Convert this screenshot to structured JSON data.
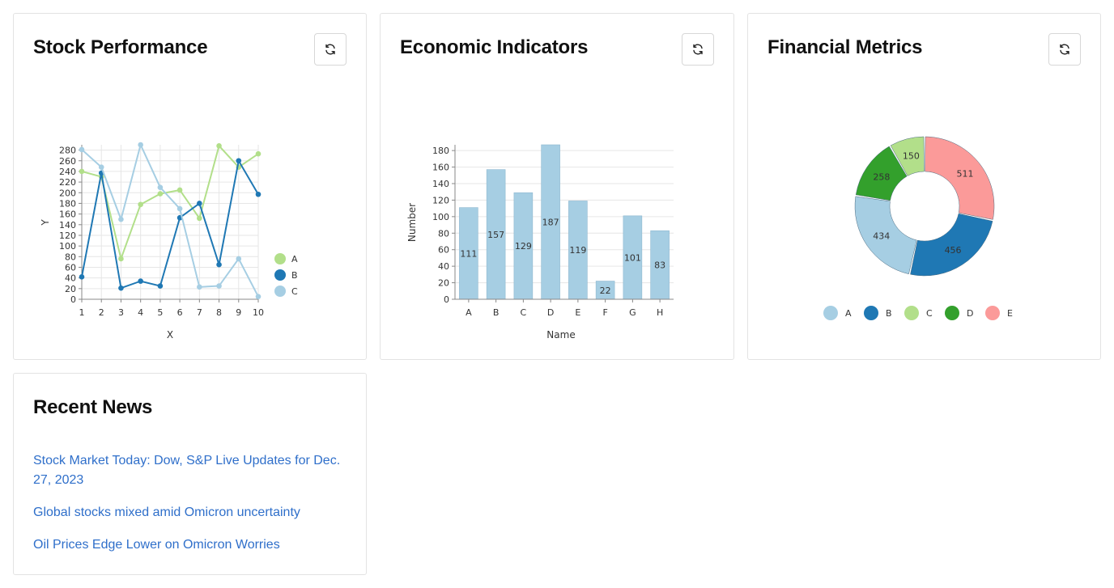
{
  "cards": {
    "stock": {
      "title": "Stock Performance",
      "refresh_icon": "refresh-icon"
    },
    "economic": {
      "title": "Economic Indicators",
      "refresh_icon": "refresh-icon"
    },
    "financial": {
      "title": "Financial Metrics",
      "refresh_icon": "refresh-icon"
    },
    "news": {
      "title": "Recent News"
    }
  },
  "news": [
    "Stock Market Today: Dow, S&P Live Updates for Dec. 27, 2023",
    "Global stocks mixed amid Omicron uncertainty",
    "Oil Prices Edge Lower on Omicron Worries"
  ],
  "colors": {
    "lightblue": "#a6cee3",
    "blue": "#1f78b4",
    "lightgreen": "#b2df8a",
    "green": "#33a02c",
    "pink": "#fb9a99",
    "link": "#2f6fca"
  },
  "chart_data": [
    {
      "type": "line",
      "xlabel": "X",
      "ylabel": "Y",
      "x": [
        1,
        2,
        3,
        4,
        5,
        6,
        7,
        8,
        9,
        10
      ],
      "ylim": [
        0,
        290
      ],
      "yticks": [
        0,
        20,
        40,
        60,
        80,
        100,
        120,
        140,
        160,
        180,
        200,
        220,
        240,
        260,
        280
      ],
      "grid": true,
      "legend": "right",
      "series": [
        {
          "name": "A",
          "color": "#b2df8a",
          "values": [
            240,
            230,
            76,
            178,
            198,
            205,
            152,
            288,
            248,
            273
          ]
        },
        {
          "name": "B",
          "color": "#1f78b4",
          "values": [
            42,
            237,
            21,
            34,
            25,
            153,
            180,
            65,
            260,
            197
          ]
        },
        {
          "name": "C",
          "color": "#a6cee3",
          "values": [
            281,
            248,
            150,
            290,
            210,
            170,
            23,
            25,
            76,
            5
          ]
        }
      ]
    },
    {
      "type": "bar",
      "xlabel": "Name",
      "ylabel": "Number",
      "categories": [
        "A",
        "B",
        "C",
        "D",
        "E",
        "F",
        "G",
        "H"
      ],
      "values": [
        111,
        157,
        129,
        187,
        119,
        22,
        101,
        83
      ],
      "ylim": [
        0,
        187
      ],
      "yticks": [
        0,
        20,
        40,
        60,
        80,
        100,
        120,
        140,
        160,
        180
      ],
      "grid": true,
      "color": "#a6cee3"
    },
    {
      "type": "pie",
      "donut": true,
      "categories": [
        "A",
        "B",
        "C",
        "D",
        "E"
      ],
      "values": [
        434,
        456,
        150,
        258,
        511
      ],
      "colors": [
        "#a6cee3",
        "#1f78b4",
        "#b2df8a",
        "#33a02c",
        "#fb9a99"
      ],
      "legend": "bottom"
    }
  ]
}
